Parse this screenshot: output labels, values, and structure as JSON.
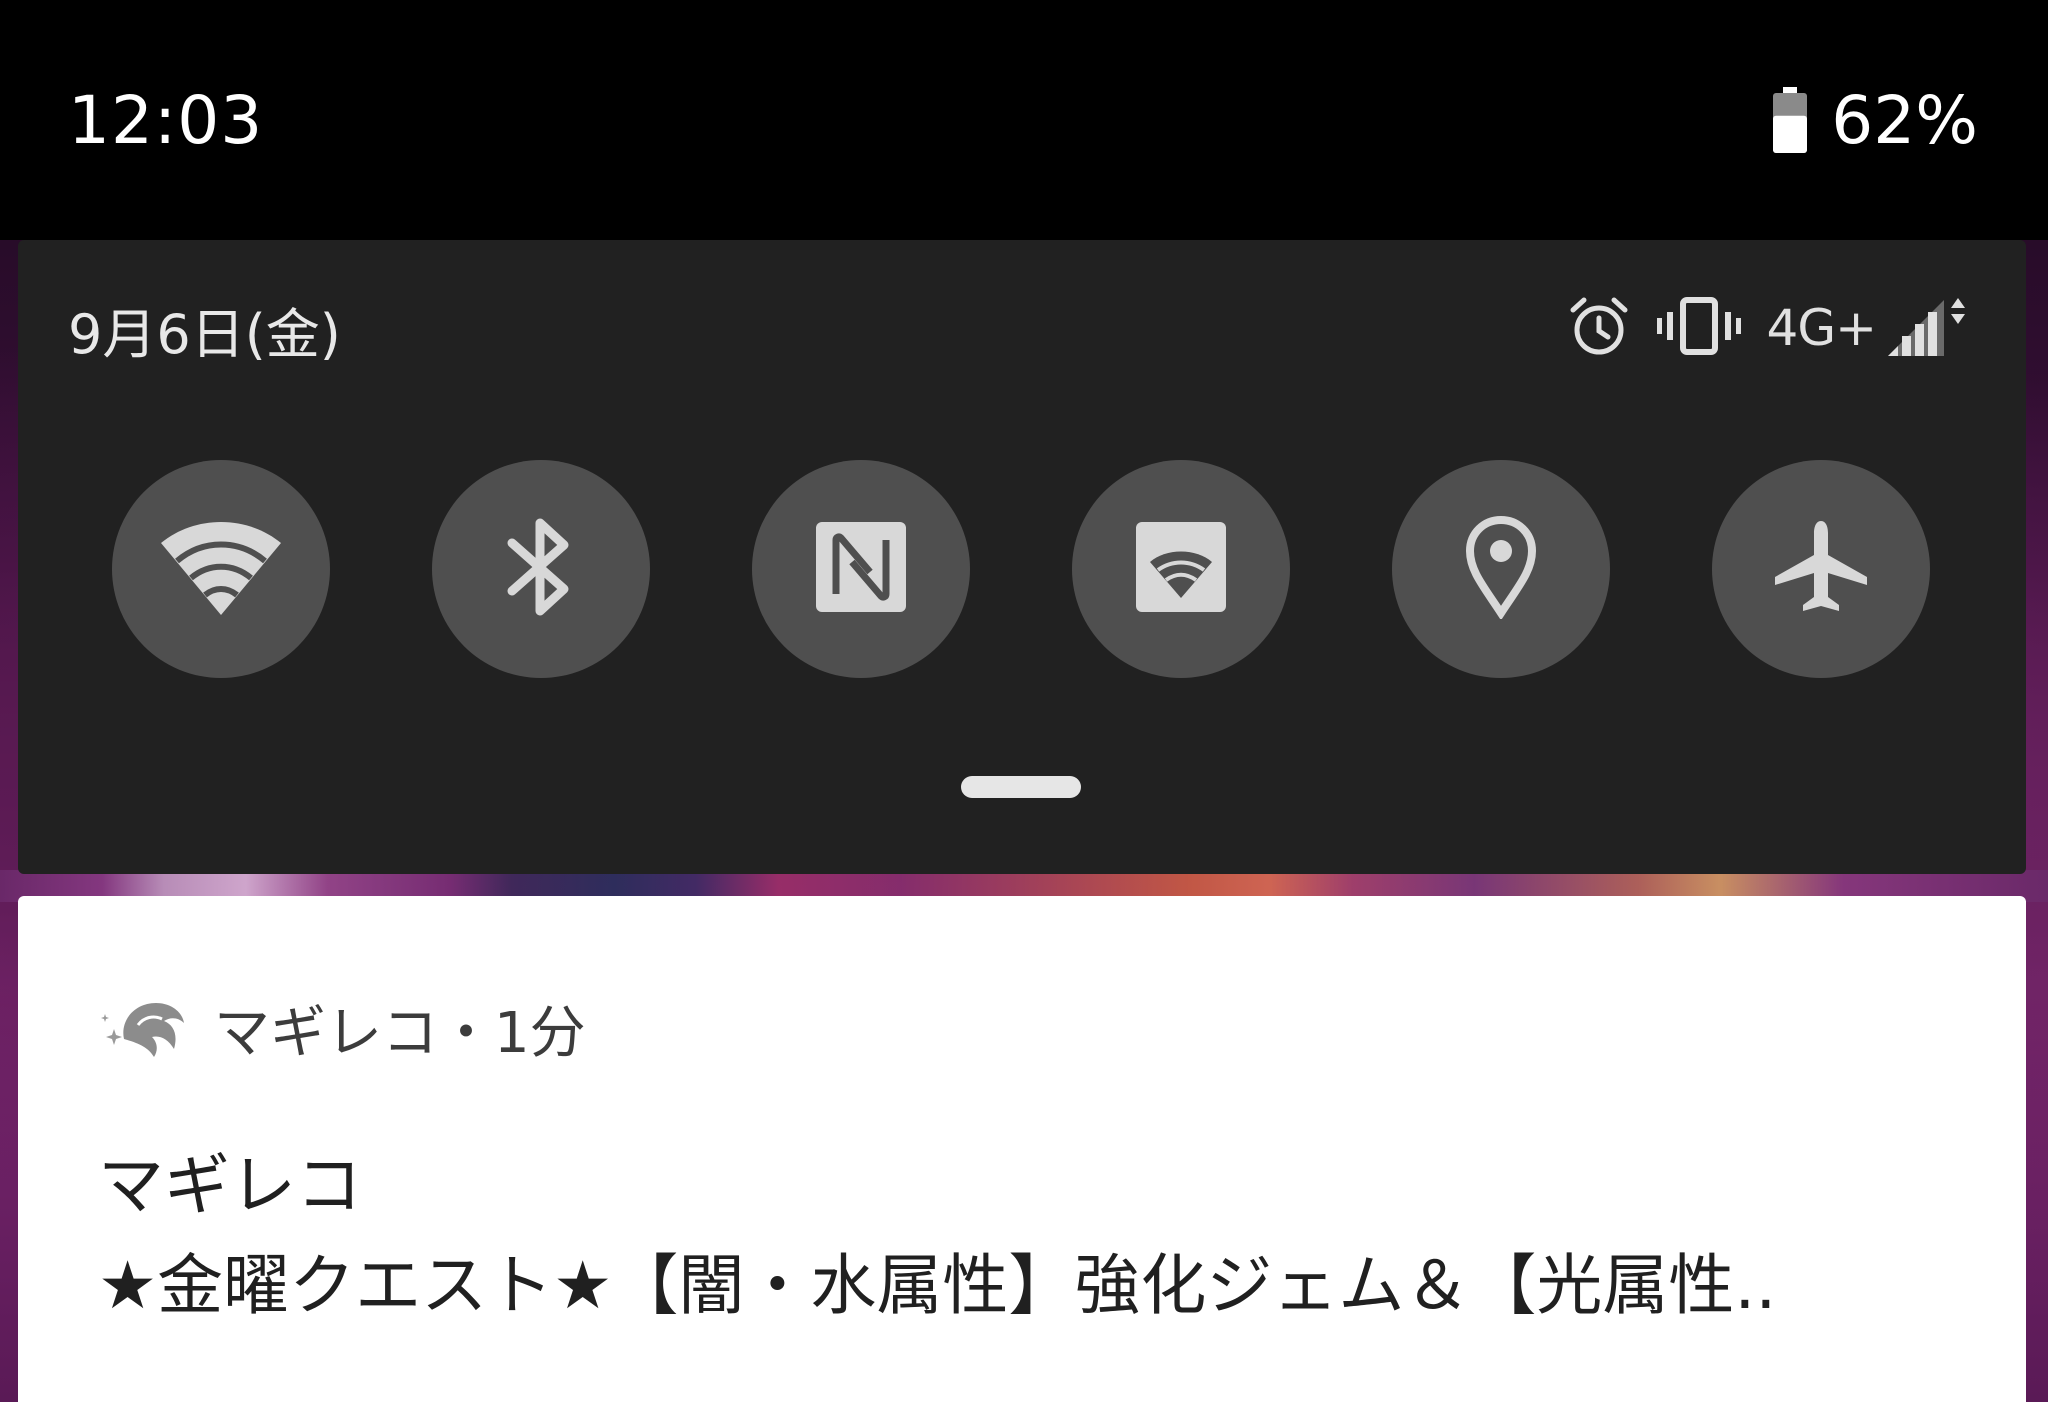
{
  "status_bar": {
    "time": "12:03",
    "battery_percent": "62%",
    "battery_level": 0.62
  },
  "quick_settings": {
    "date": "9月6日(金)",
    "network_type": "4G+",
    "status_icons": [
      "alarm-icon",
      "vibrate-icon",
      "signal-icon"
    ],
    "tiles": [
      {
        "name": "wifi",
        "icon": "wifi-icon"
      },
      {
        "name": "bluetooth",
        "icon": "bluetooth-icon"
      },
      {
        "name": "nfc",
        "icon": "nfc-icon"
      },
      {
        "name": "hotspot",
        "icon": "hotspot-icon"
      },
      {
        "name": "location",
        "icon": "location-icon"
      },
      {
        "name": "airplane",
        "icon": "airplane-icon"
      }
    ],
    "tile_color": "#4f4f4f",
    "icon_color": "#d8d8d8",
    "panel_color": "#212121"
  },
  "notification": {
    "app_meta": "マギレコ・1分",
    "title": "マギレコ",
    "body": "★金曜クエスト★【闇・水属性】強化ジェム＆【光属性.."
  }
}
